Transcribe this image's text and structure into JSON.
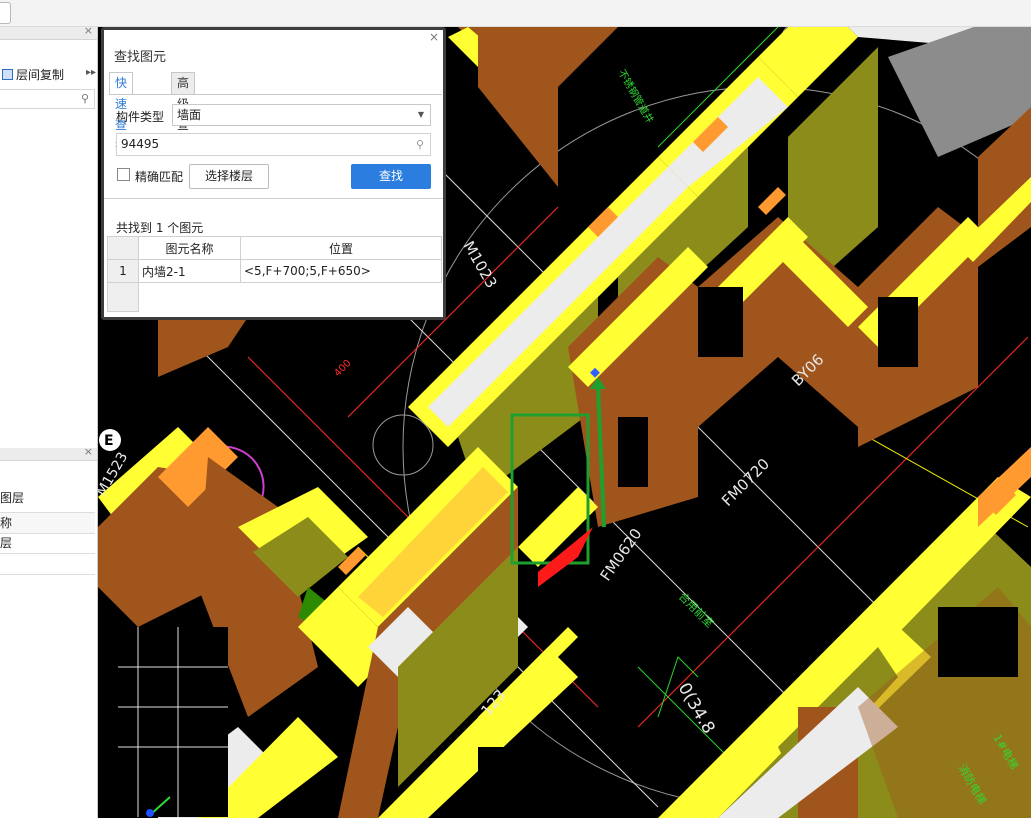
{
  "left_panel": {
    "layer_copy_label": "层间复制",
    "layer_heading": "图层",
    "table_header": "称",
    "table_row": "层"
  },
  "dialog": {
    "title": "查找图元",
    "tabs": [
      {
        "label": "快速查找",
        "active": true
      },
      {
        "label": "高级查找",
        "active": false
      }
    ],
    "component_type_label": "构件类型",
    "component_type_value": "墙面",
    "search_value": "94495",
    "exact_match_label": "精确匹配",
    "exact_match_checked": false,
    "select_floor_button": "选择楼层",
    "find_button": "查找",
    "result_summary": "共找到 1 个图元",
    "columns": [
      "图元名称",
      "位置"
    ],
    "rows": [
      {
        "index": "1",
        "name": "内墙2-1",
        "position": "<5,F+700;5,F+650>"
      }
    ]
  },
  "viewport_labels": {
    "m1023": "M1023",
    "dim_400": "400",
    "fm0620": "FM0620",
    "fm0720": "FM0720",
    "room_name": "合用前室",
    "by06": "BY06",
    "axis_e": "E",
    "m1523": "M1523",
    "x123": "123",
    "elev": "0(34.8",
    "elevator": "消防电梯",
    "elevator2": "1#电梯",
    "pipe": "不锈钢管道井"
  },
  "colors": {
    "accent": "#2b7de0",
    "canvas_bg": "#000000",
    "wall_yellow": "#ffff33",
    "wall_brown": "#a0551c",
    "selection_green": "#1fa02e"
  }
}
